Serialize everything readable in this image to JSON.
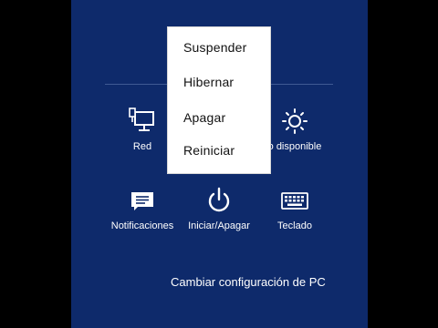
{
  "tiles": {
    "network": "Red",
    "brightness": "o disponible",
    "notifications": "Notificaciones",
    "power": "Iniciar/Apagar",
    "keyboard": "Teclado"
  },
  "power_menu": {
    "items": [
      "Suspender",
      "Hibernar",
      "Apagar",
      "Reiniciar"
    ]
  },
  "footer": {
    "settings_link": "Cambiar configuración de PC"
  },
  "colors": {
    "panel": "#0e2a6b",
    "menu": "#ffffff",
    "text_light": "#ffffff"
  },
  "icons": [
    "network-icon",
    "brightness-icon",
    "notifications-icon",
    "power-icon",
    "keyboard-icon"
  ]
}
